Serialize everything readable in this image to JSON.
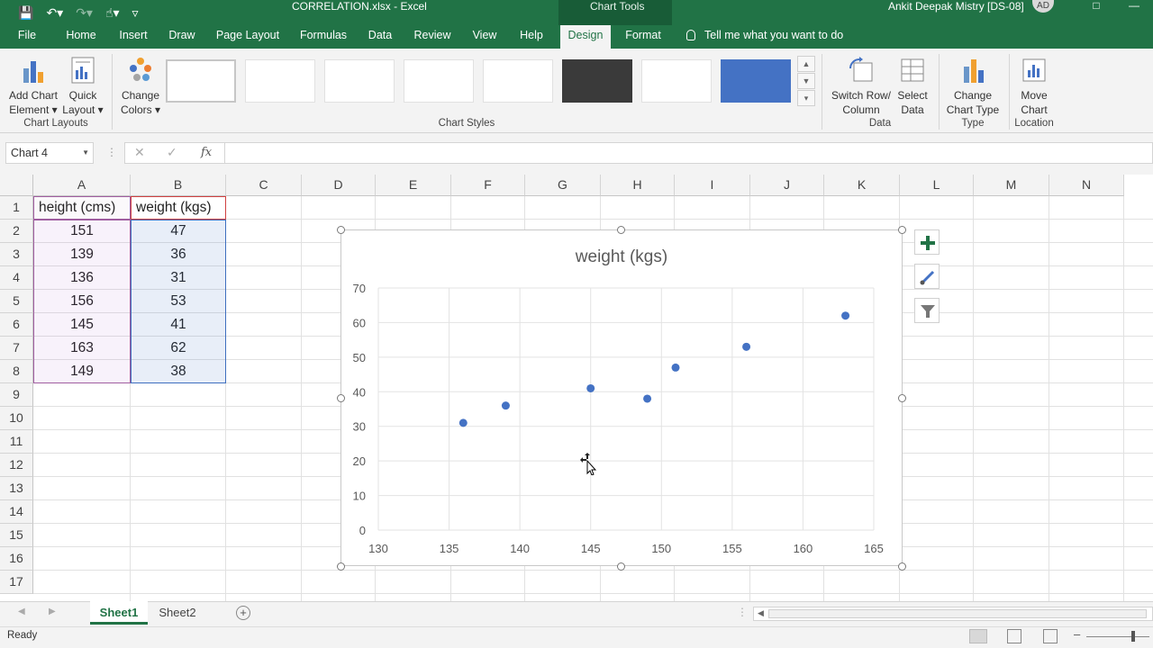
{
  "window": {
    "doc_title": "CORRELATION.xlsx  -  Excel",
    "context_tool": "Chart Tools",
    "user": "Ankit Deepak Mistry [DS-08]",
    "avatar_initials": "AD"
  },
  "ribbon": {
    "tabs": [
      {
        "label": "File",
        "active": false
      },
      {
        "label": "Home",
        "active": false
      },
      {
        "label": "Insert",
        "active": false
      },
      {
        "label": "Draw",
        "active": false
      },
      {
        "label": "Page Layout",
        "active": false
      },
      {
        "label": "Formulas",
        "active": false
      },
      {
        "label": "Data",
        "active": false
      },
      {
        "label": "Review",
        "active": false
      },
      {
        "label": "View",
        "active": false
      },
      {
        "label": "Help",
        "active": false
      },
      {
        "label": "Design",
        "active": true
      },
      {
        "label": "Format",
        "active": false
      }
    ],
    "tell_me": "Tell me what you want to do",
    "buttons": {
      "add_chart_element": [
        "Add Chart",
        "Element ▾"
      ],
      "quick_layout": [
        "Quick",
        "Layout ▾"
      ],
      "change_colors": [
        "Change",
        "Colors ▾"
      ],
      "switch_row_column": [
        "Switch Row/",
        "Column"
      ],
      "select_data": [
        "Select",
        "Data"
      ],
      "change_chart_type": [
        "Change",
        "Chart Type"
      ],
      "move_chart": [
        "Move",
        "Chart"
      ]
    },
    "groups": {
      "chart_layouts": "Chart Layouts",
      "chart_styles": "Chart Styles",
      "data": "Data",
      "type": "Type",
      "location": "Location"
    }
  },
  "formula_bar": {
    "name_box": "Chart 4",
    "fx": "fx",
    "formula": ""
  },
  "sheet": {
    "columns": [
      "A",
      "B",
      "C",
      "D",
      "E",
      "F",
      "G",
      "H",
      "I",
      "J",
      "K",
      "L",
      "M",
      "N"
    ],
    "rows": [
      "1",
      "2",
      "3",
      "4",
      "5",
      "6",
      "7",
      "8",
      "9",
      "10",
      "11",
      "12",
      "13",
      "14",
      "15",
      "16",
      "17"
    ],
    "headers": {
      "A": "height (cms)",
      "B": "weight (kgs)"
    },
    "height": [
      "151",
      "139",
      "136",
      "156",
      "145",
      "163",
      "149"
    ],
    "weight": [
      "47",
      "36",
      "31",
      "53",
      "41",
      "62",
      "38"
    ]
  },
  "chart_data": {
    "type": "scatter",
    "title": "weight (kgs)",
    "x": [
      151,
      139,
      136,
      156,
      145,
      163,
      149
    ],
    "y": [
      47,
      36,
      31,
      53,
      41,
      62,
      38
    ],
    "xlim": [
      130,
      165
    ],
    "ylim": [
      0,
      70
    ],
    "xticks": [
      "130",
      "135",
      "140",
      "145",
      "150",
      "155",
      "160",
      "165"
    ],
    "yticks": [
      "0",
      "10",
      "20",
      "30",
      "40",
      "50",
      "60",
      "70"
    ],
    "grid": true,
    "legend": "none",
    "marker_color": "#4472c4"
  },
  "sheet_tabs": [
    {
      "label": "Sheet1",
      "active": true
    },
    {
      "label": "Sheet2",
      "active": false
    }
  ],
  "status": {
    "text": "Ready"
  },
  "colors": {
    "excel_green": "#217346",
    "accent_blue": "#4472c4"
  }
}
